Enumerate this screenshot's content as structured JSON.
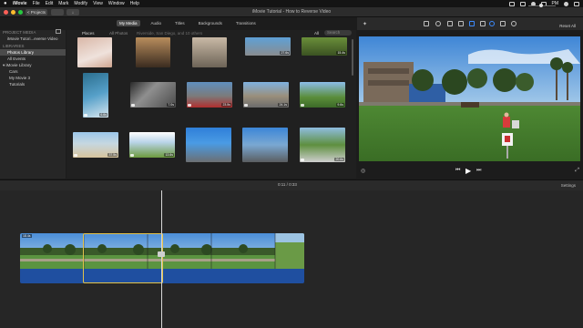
{
  "menubar": {
    "app_name": "iMovie",
    "items": [
      "File",
      "Edit",
      "Mark",
      "Modify",
      "View",
      "Window",
      "Help"
    ],
    "clock": "PM"
  },
  "toolbar": {
    "projects_label": "< Projects",
    "window_title": "iMovie Tutorial - How to Reverse Video",
    "reset_all": "Reset All"
  },
  "media_tabs": [
    {
      "label": "My Media",
      "active": true
    },
    {
      "label": "Audio",
      "active": false
    },
    {
      "label": "Titles",
      "active": false
    },
    {
      "label": "Backgrounds",
      "active": false
    },
    {
      "label": "Transitions",
      "active": false
    }
  ],
  "sidebar": {
    "project_media_header": "PROJECT MEDIA",
    "project_item": "iMovie Tutori...everse Video",
    "libraries_header": "LIBRARIES",
    "items": [
      {
        "label": "Photos Library",
        "selected": true
      },
      {
        "label": "All Events",
        "selected": false
      },
      {
        "label": "iMovie Library",
        "selected": false
      },
      {
        "label": "Cars",
        "selected": false
      },
      {
        "label": "My Movie 3",
        "selected": false
      },
      {
        "label": "Tutorials",
        "selected": false
      }
    ]
  },
  "browser": {
    "places_label": "Places",
    "all_photos_label": "All Photos",
    "locations_label": "Riverside, San Diego, and 10 others",
    "all_label": "All",
    "search_placeholder": "Search",
    "durations": [
      "27.6s",
      "15.4s",
      "6.6s",
      "7.0s",
      "23.5s",
      "24.1s",
      "9.6s",
      "37.5s",
      "13.6s",
      "20.6s"
    ]
  },
  "timeline": {
    "timecode": "0:11 / 0:33",
    "settings_label": "Settings",
    "clip_label": "18.4s"
  },
  "colors": {
    "selection": "#e2c24a",
    "audio": "#1f4fa0",
    "menubar": "#141414"
  }
}
